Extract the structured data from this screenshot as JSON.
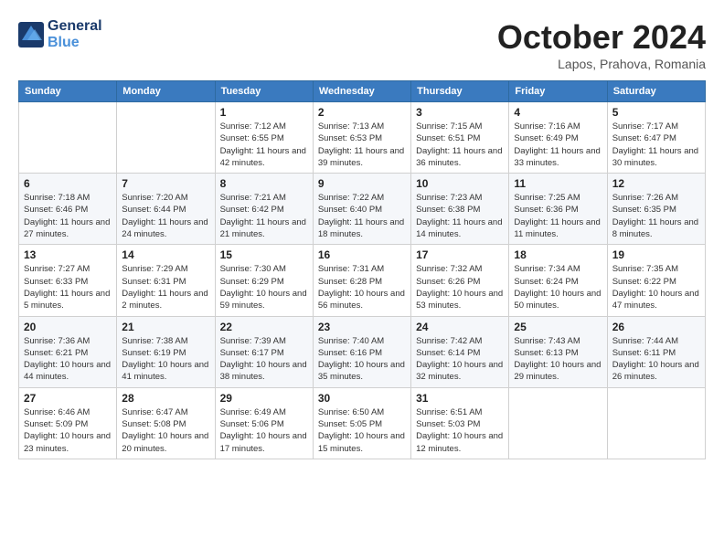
{
  "logo": {
    "line1": "General",
    "line2": "Blue"
  },
  "title": "October 2024",
  "location": "Lapos, Prahova, Romania",
  "headers": [
    "Sunday",
    "Monday",
    "Tuesday",
    "Wednesday",
    "Thursday",
    "Friday",
    "Saturday"
  ],
  "weeks": [
    [
      {
        "day": "",
        "info": ""
      },
      {
        "day": "",
        "info": ""
      },
      {
        "day": "1",
        "info": "Sunrise: 7:12 AM\nSunset: 6:55 PM\nDaylight: 11 hours and 42 minutes."
      },
      {
        "day": "2",
        "info": "Sunrise: 7:13 AM\nSunset: 6:53 PM\nDaylight: 11 hours and 39 minutes."
      },
      {
        "day": "3",
        "info": "Sunrise: 7:15 AM\nSunset: 6:51 PM\nDaylight: 11 hours and 36 minutes."
      },
      {
        "day": "4",
        "info": "Sunrise: 7:16 AM\nSunset: 6:49 PM\nDaylight: 11 hours and 33 minutes."
      },
      {
        "day": "5",
        "info": "Sunrise: 7:17 AM\nSunset: 6:47 PM\nDaylight: 11 hours and 30 minutes."
      }
    ],
    [
      {
        "day": "6",
        "info": "Sunrise: 7:18 AM\nSunset: 6:46 PM\nDaylight: 11 hours and 27 minutes."
      },
      {
        "day": "7",
        "info": "Sunrise: 7:20 AM\nSunset: 6:44 PM\nDaylight: 11 hours and 24 minutes."
      },
      {
        "day": "8",
        "info": "Sunrise: 7:21 AM\nSunset: 6:42 PM\nDaylight: 11 hours and 21 minutes."
      },
      {
        "day": "9",
        "info": "Sunrise: 7:22 AM\nSunset: 6:40 PM\nDaylight: 11 hours and 18 minutes."
      },
      {
        "day": "10",
        "info": "Sunrise: 7:23 AM\nSunset: 6:38 PM\nDaylight: 11 hours and 14 minutes."
      },
      {
        "day": "11",
        "info": "Sunrise: 7:25 AM\nSunset: 6:36 PM\nDaylight: 11 hours and 11 minutes."
      },
      {
        "day": "12",
        "info": "Sunrise: 7:26 AM\nSunset: 6:35 PM\nDaylight: 11 hours and 8 minutes."
      }
    ],
    [
      {
        "day": "13",
        "info": "Sunrise: 7:27 AM\nSunset: 6:33 PM\nDaylight: 11 hours and 5 minutes."
      },
      {
        "day": "14",
        "info": "Sunrise: 7:29 AM\nSunset: 6:31 PM\nDaylight: 11 hours and 2 minutes."
      },
      {
        "day": "15",
        "info": "Sunrise: 7:30 AM\nSunset: 6:29 PM\nDaylight: 10 hours and 59 minutes."
      },
      {
        "day": "16",
        "info": "Sunrise: 7:31 AM\nSunset: 6:28 PM\nDaylight: 10 hours and 56 minutes."
      },
      {
        "day": "17",
        "info": "Sunrise: 7:32 AM\nSunset: 6:26 PM\nDaylight: 10 hours and 53 minutes."
      },
      {
        "day": "18",
        "info": "Sunrise: 7:34 AM\nSunset: 6:24 PM\nDaylight: 10 hours and 50 minutes."
      },
      {
        "day": "19",
        "info": "Sunrise: 7:35 AM\nSunset: 6:22 PM\nDaylight: 10 hours and 47 minutes."
      }
    ],
    [
      {
        "day": "20",
        "info": "Sunrise: 7:36 AM\nSunset: 6:21 PM\nDaylight: 10 hours and 44 minutes."
      },
      {
        "day": "21",
        "info": "Sunrise: 7:38 AM\nSunset: 6:19 PM\nDaylight: 10 hours and 41 minutes."
      },
      {
        "day": "22",
        "info": "Sunrise: 7:39 AM\nSunset: 6:17 PM\nDaylight: 10 hours and 38 minutes."
      },
      {
        "day": "23",
        "info": "Sunrise: 7:40 AM\nSunset: 6:16 PM\nDaylight: 10 hours and 35 minutes."
      },
      {
        "day": "24",
        "info": "Sunrise: 7:42 AM\nSunset: 6:14 PM\nDaylight: 10 hours and 32 minutes."
      },
      {
        "day": "25",
        "info": "Sunrise: 7:43 AM\nSunset: 6:13 PM\nDaylight: 10 hours and 29 minutes."
      },
      {
        "day": "26",
        "info": "Sunrise: 7:44 AM\nSunset: 6:11 PM\nDaylight: 10 hours and 26 minutes."
      }
    ],
    [
      {
        "day": "27",
        "info": "Sunrise: 6:46 AM\nSunset: 5:09 PM\nDaylight: 10 hours and 23 minutes."
      },
      {
        "day": "28",
        "info": "Sunrise: 6:47 AM\nSunset: 5:08 PM\nDaylight: 10 hours and 20 minutes."
      },
      {
        "day": "29",
        "info": "Sunrise: 6:49 AM\nSunset: 5:06 PM\nDaylight: 10 hours and 17 minutes."
      },
      {
        "day": "30",
        "info": "Sunrise: 6:50 AM\nSunset: 5:05 PM\nDaylight: 10 hours and 15 minutes."
      },
      {
        "day": "31",
        "info": "Sunrise: 6:51 AM\nSunset: 5:03 PM\nDaylight: 10 hours and 12 minutes."
      },
      {
        "day": "",
        "info": ""
      },
      {
        "day": "",
        "info": ""
      }
    ]
  ]
}
